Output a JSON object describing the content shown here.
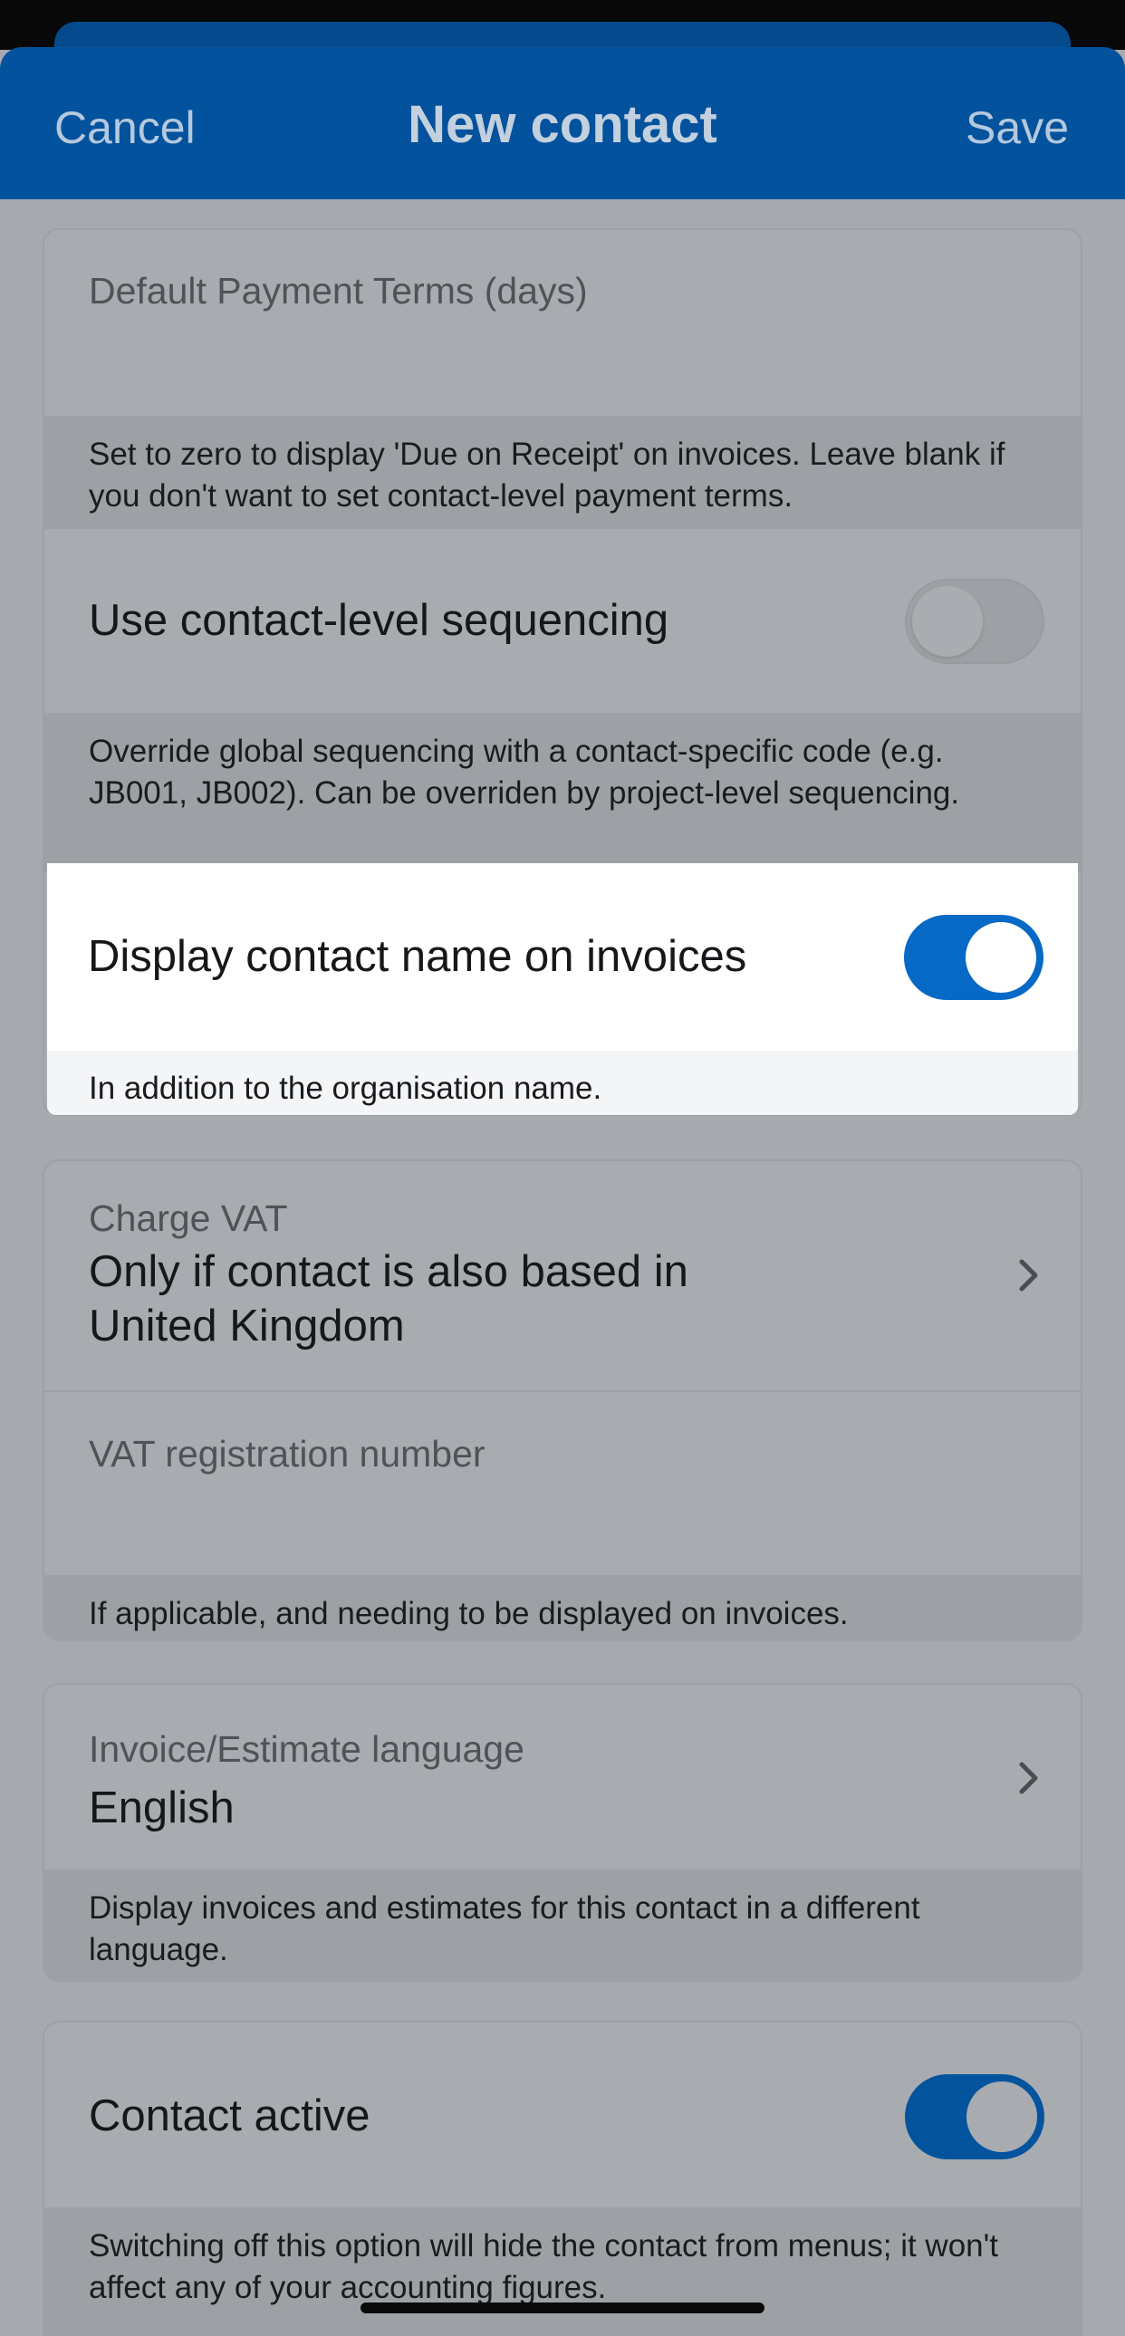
{
  "header": {
    "cancel_label": "Cancel",
    "title": "New contact",
    "save_label": "Save"
  },
  "payment_terms": {
    "label": "Default Payment Terms (days)",
    "value": "",
    "note": "Set to zero to display 'Due on Receipt' on invoices. Leave blank if you don't want to set contact-level payment terms."
  },
  "sequencing": {
    "label": "Use contact-level sequencing",
    "enabled": false,
    "note": "Override global sequencing with a contact-specific code (e.g. JB001, JB002). Can be overriden by project-level sequencing."
  },
  "display_name": {
    "label": "Display contact name on invoices",
    "enabled": true,
    "note": "In addition to the organisation name."
  },
  "vat": {
    "charge_label": "Charge VAT",
    "charge_value": "Only if contact is also based in United Kingdom",
    "reg_label": "VAT registration number",
    "reg_value": "",
    "note": "If applicable, and needing to be displayed on invoices."
  },
  "language": {
    "label": "Invoice/Estimate language",
    "value": "English",
    "note": "Display invoices and estimates for this contact in a different language."
  },
  "active": {
    "label": "Contact active",
    "enabled": true,
    "note": "Switching off this option will hide the contact from menus; it won't affect any of your accounting figures."
  },
  "colors": {
    "header_bg": "#03529d",
    "toggle_on": "#0669c6",
    "overlay_bg": "#a6aaaf"
  }
}
